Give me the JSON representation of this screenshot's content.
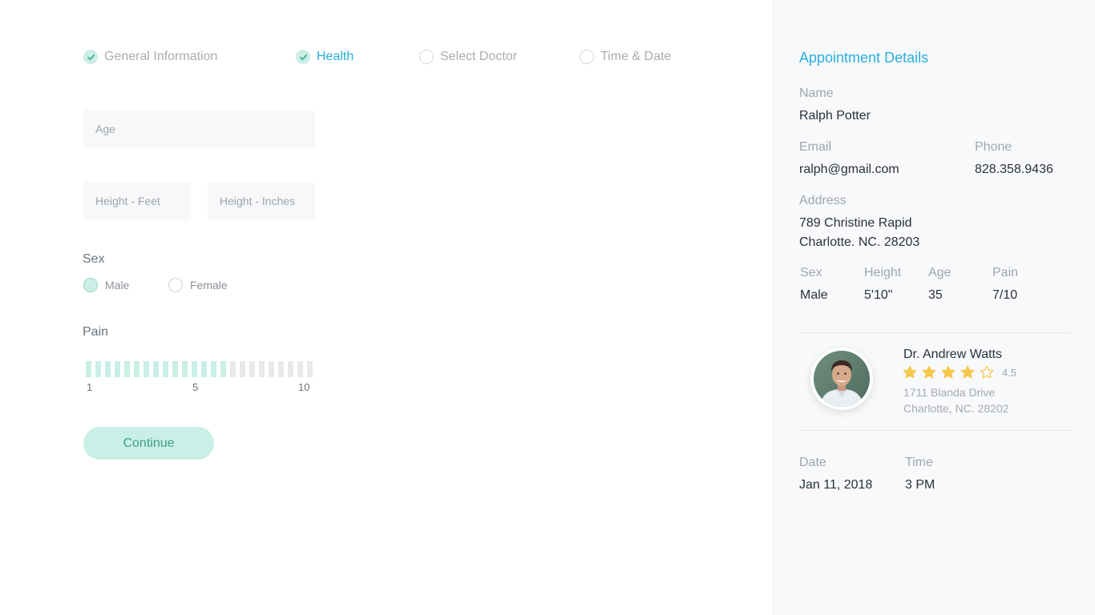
{
  "steps": [
    {
      "label": "General Information",
      "status": "done"
    },
    {
      "label": "Health",
      "status": "active"
    },
    {
      "label": "Select Doctor",
      "status": "todo"
    },
    {
      "label": "Time & Date",
      "status": "todo"
    }
  ],
  "form": {
    "age_placeholder": "Age",
    "height_feet_placeholder": "Height - Feet",
    "height_inches_placeholder": "Height - Inches",
    "sex_label": "Sex",
    "sex_options": [
      "Male",
      "Female"
    ],
    "sex_selected": "Male",
    "pain_label": "Pain",
    "pain_scale": {
      "min": "1",
      "mid": "5",
      "max": "10",
      "total_segments": 24,
      "filled_segments": 15
    },
    "continue_label": "Continue"
  },
  "summary": {
    "title": "Appointment Details",
    "name_label": "Name",
    "name_value": "Ralph Potter",
    "email_label": "Email",
    "email_value": "ralph@gmail.com",
    "phone_label": "Phone",
    "phone_value": "828.358.9436",
    "address_label": "Address",
    "address_line1": "789 Christine Rapid",
    "address_line2": "Charlotte. NC. 28203",
    "sex_label": "Sex",
    "sex_value": "Male",
    "height_label": "Height",
    "height_value": "5'10\"",
    "age_label": "Age",
    "age_value": "35",
    "pain_label": "Pain",
    "pain_value": "7/10",
    "doctor": {
      "name": "Dr. Andrew Watts",
      "rating": "4.5",
      "stars_filled": 4,
      "stars_total": 5,
      "address_line1": "1711 Blanda Drive",
      "address_line2": "Charlotte, NC. 28202"
    },
    "date_label": "Date",
    "date_value": "Jan 11, 2018",
    "time_label": "Time",
    "time_value": "3 PM"
  },
  "colors": {
    "accent_blue": "#29aee0",
    "mint": "#c9efe7",
    "mint_text": "#3d9d89",
    "star": "#f5c84c"
  }
}
